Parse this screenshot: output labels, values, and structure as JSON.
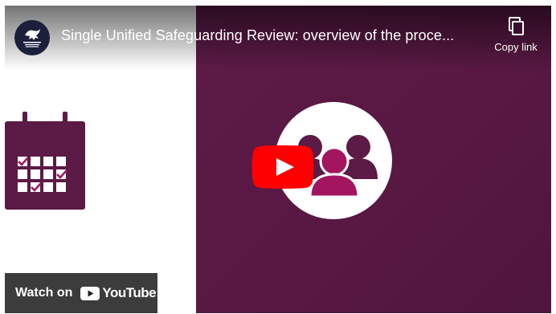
{
  "video": {
    "title": "Single Unified Safeguarding Review: overview of the proce...",
    "copy_link_label": "Copy link",
    "watch_on_label": "Watch on",
    "youtube_wordmark": "YouTube"
  },
  "icons": {
    "channel": "welsh-government-logo",
    "copy": "copy-icon",
    "play": "play-icon",
    "calendar": "calendar-icon",
    "people": "people-group-icon",
    "youtube": "youtube-logo-icon"
  },
  "colors": {
    "brand_plum": "#5c1a46",
    "accent_magenta": "#a3165f",
    "youtube_red": "#ff0000"
  }
}
